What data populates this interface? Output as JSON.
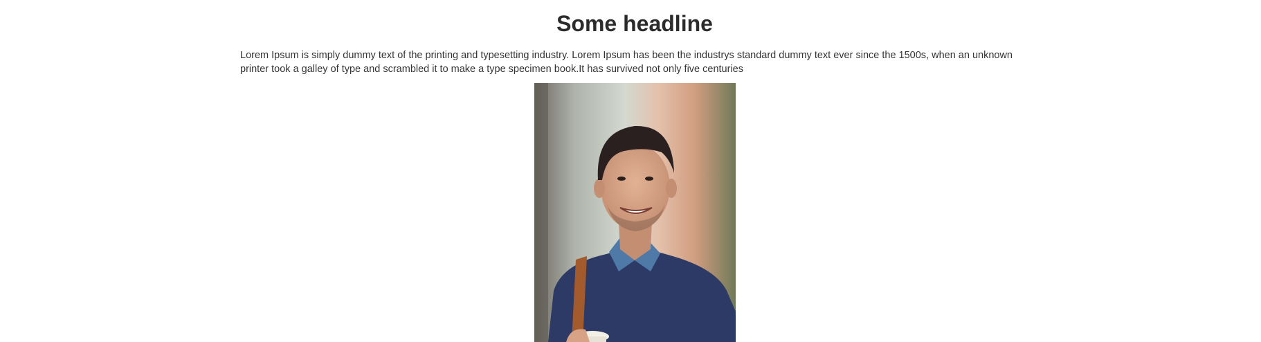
{
  "article": {
    "headline": "Some headline",
    "paragraph": "Lorem Ipsum is simply dummy text of the printing and typesetting industry. Lorem Ipsum has been the industrys standard dummy text ever since the 1500s, when an unknown printer took a galley of type and scrambled it to make a type specimen book.It has survived not only five centuries"
  },
  "colors": {
    "text": "#333333",
    "headline": "#2b2b2b",
    "background": "#ffffff",
    "sweater": "#2d3a66",
    "shirt": "#4f7aa8",
    "skin": "#d9a68a",
    "hair": "#2a2020",
    "strap": "#a35a2c"
  }
}
